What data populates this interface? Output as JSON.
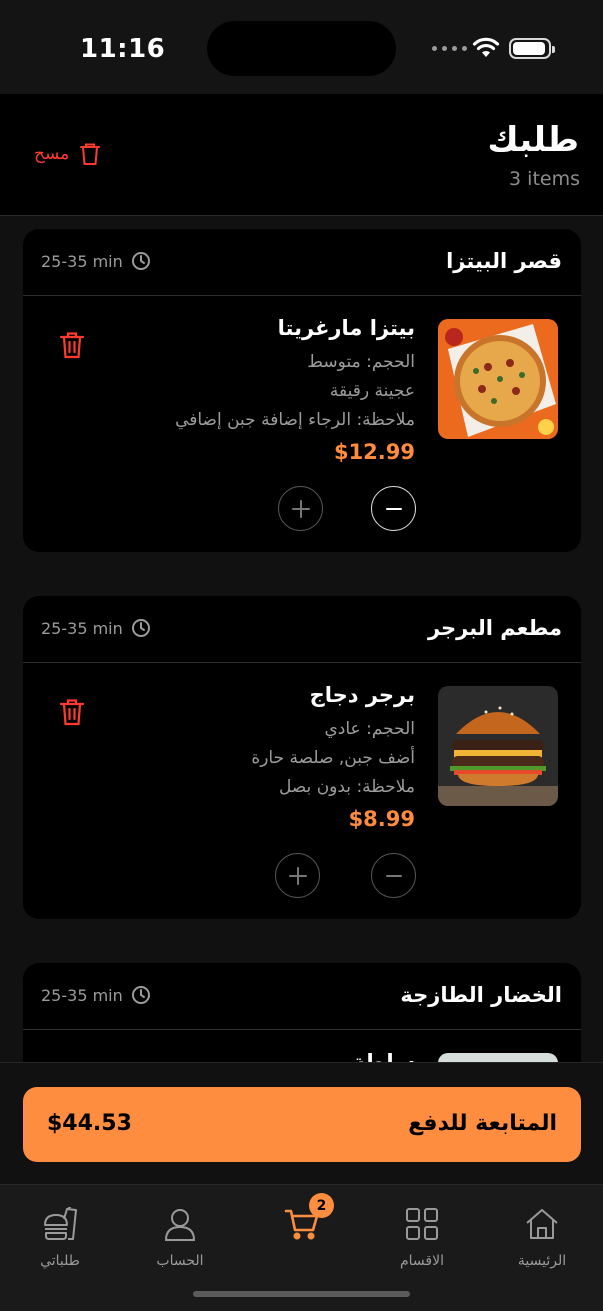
{
  "status_bar": {
    "time": "11:16"
  },
  "header": {
    "title": "طلبك",
    "item_count": "3 items",
    "clear_label": "مسح"
  },
  "restaurants": [
    {
      "name": "قصر البيتزا",
      "eta": "25-35 min",
      "item": {
        "name": "بيتزا مارغريتا",
        "lines": [
          "الحجم: متوسط",
          "عجينة رقيقة",
          "ملاحظة: الرجاء إضافة جبن إضافي"
        ],
        "price": "$12.99",
        "image": "pizza"
      }
    },
    {
      "name": "مطعم البرجر",
      "eta": "25-35 min",
      "item": {
        "name": "برجر دجاج",
        "lines": [
          "الحجم: عادي",
          "أضف جبن, صلصة حارة",
          "ملاحظة: بدون بصل"
        ],
        "price": "$8.99",
        "image": "burger"
      }
    },
    {
      "name": "الخضار الطازجة",
      "eta": "25-35 min",
      "item": {
        "name": "سلطة",
        "image": "salad"
      }
    }
  ],
  "checkout": {
    "label": "المتابعة للدفع",
    "total": "$44.53"
  },
  "tabbar": {
    "items": [
      {
        "label": "الرئيسية",
        "icon": "home-icon"
      },
      {
        "label": "الاقسام",
        "icon": "grid-icon"
      },
      {
        "label": "",
        "icon": "cart-icon",
        "badge": "2",
        "active": true
      },
      {
        "label": "الحساب",
        "icon": "user-icon"
      },
      {
        "label": "طلباتي",
        "icon": "food-icon"
      }
    ]
  },
  "colors": {
    "accent": "#ff8d40",
    "danger": "#ff3b30",
    "background": "#111111",
    "card": "#000000"
  }
}
